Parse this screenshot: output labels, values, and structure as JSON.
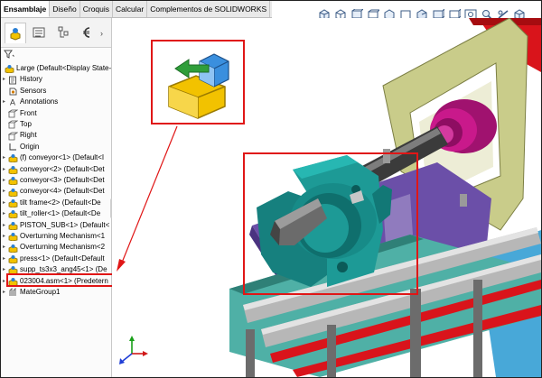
{
  "tabs": [
    "Ensamblaje",
    "Diseño",
    "Croquis",
    "Calcular",
    "Complementos de SOLIDWORKS"
  ],
  "tree": {
    "root": "Large  (Default<Display State-",
    "items": [
      {
        "label": "History",
        "icon": "history-icon",
        "arrow": true
      },
      {
        "label": "Sensors",
        "icon": "sensors-icon",
        "arrow": false
      },
      {
        "label": "Annotations",
        "icon": "annotations-icon",
        "arrow": true
      },
      {
        "label": "Front",
        "icon": "plane-icon",
        "arrow": false
      },
      {
        "label": "Top",
        "icon": "plane-icon",
        "arrow": false
      },
      {
        "label": "Right",
        "icon": "plane-icon",
        "arrow": false
      },
      {
        "label": "Origin",
        "icon": "origin-icon",
        "arrow": false
      },
      {
        "label": "(f) conveyor<1> (Default<I",
        "icon": "part-icon",
        "arrow": true
      },
      {
        "label": "conveyor<2> (Default<Det",
        "icon": "part-icon",
        "arrow": true
      },
      {
        "label": "conveyor<3> (Default<Det",
        "icon": "part-icon",
        "arrow": true
      },
      {
        "label": "conveyor<4> (Default<Det",
        "icon": "part-icon",
        "arrow": true
      },
      {
        "label": "tilt frame<2> (Default<De",
        "icon": "part-icon",
        "arrow": true
      },
      {
        "label": "tilt_roller<1> (Default<De",
        "icon": "part-icon",
        "arrow": true
      },
      {
        "label": "PISTON_SUB<1> (Default<",
        "icon": "part-icon",
        "arrow": true
      },
      {
        "label": "Overturning Mechanism<1",
        "icon": "part-icon",
        "arrow": true
      },
      {
        "label": "Overturning Mechanism<2",
        "icon": "part-icon",
        "arrow": true
      },
      {
        "label": "press<1> (Default<Default",
        "icon": "part-icon",
        "arrow": true
      },
      {
        "label": "supp_ts3x3_ang45<1> (De",
        "icon": "part-icon",
        "arrow": true
      },
      {
        "label": "023004.asm<1> (Predetern",
        "icon": "part-icon",
        "arrow": true
      },
      {
        "label": "MateGroup1",
        "icon": "mates-icon",
        "arrow": true
      }
    ]
  },
  "colors": {
    "highlight": "#e01616",
    "teal": "#1d8c8c",
    "purple": "#6b4fa8",
    "magenta": "#b0157a",
    "olive": "#c7c98a"
  }
}
